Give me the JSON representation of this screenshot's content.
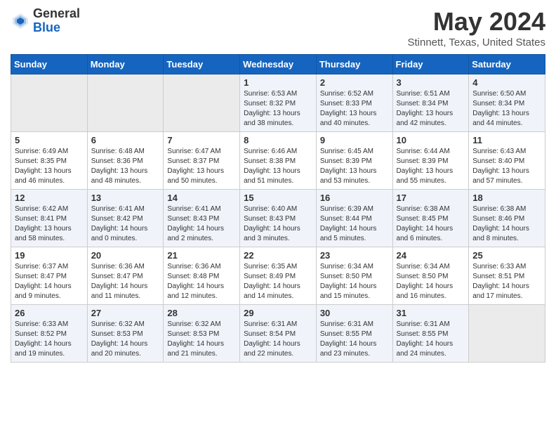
{
  "header": {
    "logo_general": "General",
    "logo_blue": "Blue",
    "title": "May 2024",
    "location": "Stinnett, Texas, United States"
  },
  "days_of_week": [
    "Sunday",
    "Monday",
    "Tuesday",
    "Wednesday",
    "Thursday",
    "Friday",
    "Saturday"
  ],
  "weeks": [
    [
      {
        "day": "",
        "info": ""
      },
      {
        "day": "",
        "info": ""
      },
      {
        "day": "",
        "info": ""
      },
      {
        "day": "1",
        "info": "Sunrise: 6:53 AM\nSunset: 8:32 PM\nDaylight: 13 hours\nand 38 minutes."
      },
      {
        "day": "2",
        "info": "Sunrise: 6:52 AM\nSunset: 8:33 PM\nDaylight: 13 hours\nand 40 minutes."
      },
      {
        "day": "3",
        "info": "Sunrise: 6:51 AM\nSunset: 8:34 PM\nDaylight: 13 hours\nand 42 minutes."
      },
      {
        "day": "4",
        "info": "Sunrise: 6:50 AM\nSunset: 8:34 PM\nDaylight: 13 hours\nand 44 minutes."
      }
    ],
    [
      {
        "day": "5",
        "info": "Sunrise: 6:49 AM\nSunset: 8:35 PM\nDaylight: 13 hours\nand 46 minutes."
      },
      {
        "day": "6",
        "info": "Sunrise: 6:48 AM\nSunset: 8:36 PM\nDaylight: 13 hours\nand 48 minutes."
      },
      {
        "day": "7",
        "info": "Sunrise: 6:47 AM\nSunset: 8:37 PM\nDaylight: 13 hours\nand 50 minutes."
      },
      {
        "day": "8",
        "info": "Sunrise: 6:46 AM\nSunset: 8:38 PM\nDaylight: 13 hours\nand 51 minutes."
      },
      {
        "day": "9",
        "info": "Sunrise: 6:45 AM\nSunset: 8:39 PM\nDaylight: 13 hours\nand 53 minutes."
      },
      {
        "day": "10",
        "info": "Sunrise: 6:44 AM\nSunset: 8:39 PM\nDaylight: 13 hours\nand 55 minutes."
      },
      {
        "day": "11",
        "info": "Sunrise: 6:43 AM\nSunset: 8:40 PM\nDaylight: 13 hours\nand 57 minutes."
      }
    ],
    [
      {
        "day": "12",
        "info": "Sunrise: 6:42 AM\nSunset: 8:41 PM\nDaylight: 13 hours\nand 58 minutes."
      },
      {
        "day": "13",
        "info": "Sunrise: 6:41 AM\nSunset: 8:42 PM\nDaylight: 14 hours\nand 0 minutes."
      },
      {
        "day": "14",
        "info": "Sunrise: 6:41 AM\nSunset: 8:43 PM\nDaylight: 14 hours\nand 2 minutes."
      },
      {
        "day": "15",
        "info": "Sunrise: 6:40 AM\nSunset: 8:43 PM\nDaylight: 14 hours\nand 3 minutes."
      },
      {
        "day": "16",
        "info": "Sunrise: 6:39 AM\nSunset: 8:44 PM\nDaylight: 14 hours\nand 5 minutes."
      },
      {
        "day": "17",
        "info": "Sunrise: 6:38 AM\nSunset: 8:45 PM\nDaylight: 14 hours\nand 6 minutes."
      },
      {
        "day": "18",
        "info": "Sunrise: 6:38 AM\nSunset: 8:46 PM\nDaylight: 14 hours\nand 8 minutes."
      }
    ],
    [
      {
        "day": "19",
        "info": "Sunrise: 6:37 AM\nSunset: 8:47 PM\nDaylight: 14 hours\nand 9 minutes."
      },
      {
        "day": "20",
        "info": "Sunrise: 6:36 AM\nSunset: 8:47 PM\nDaylight: 14 hours\nand 11 minutes."
      },
      {
        "day": "21",
        "info": "Sunrise: 6:36 AM\nSunset: 8:48 PM\nDaylight: 14 hours\nand 12 minutes."
      },
      {
        "day": "22",
        "info": "Sunrise: 6:35 AM\nSunset: 8:49 PM\nDaylight: 14 hours\nand 14 minutes."
      },
      {
        "day": "23",
        "info": "Sunrise: 6:34 AM\nSunset: 8:50 PM\nDaylight: 14 hours\nand 15 minutes."
      },
      {
        "day": "24",
        "info": "Sunrise: 6:34 AM\nSunset: 8:50 PM\nDaylight: 14 hours\nand 16 minutes."
      },
      {
        "day": "25",
        "info": "Sunrise: 6:33 AM\nSunset: 8:51 PM\nDaylight: 14 hours\nand 17 minutes."
      }
    ],
    [
      {
        "day": "26",
        "info": "Sunrise: 6:33 AM\nSunset: 8:52 PM\nDaylight: 14 hours\nand 19 minutes."
      },
      {
        "day": "27",
        "info": "Sunrise: 6:32 AM\nSunset: 8:53 PM\nDaylight: 14 hours\nand 20 minutes."
      },
      {
        "day": "28",
        "info": "Sunrise: 6:32 AM\nSunset: 8:53 PM\nDaylight: 14 hours\nand 21 minutes."
      },
      {
        "day": "29",
        "info": "Sunrise: 6:31 AM\nSunset: 8:54 PM\nDaylight: 14 hours\nand 22 minutes."
      },
      {
        "day": "30",
        "info": "Sunrise: 6:31 AM\nSunset: 8:55 PM\nDaylight: 14 hours\nand 23 minutes."
      },
      {
        "day": "31",
        "info": "Sunrise: 6:31 AM\nSunset: 8:55 PM\nDaylight: 14 hours\nand 24 minutes."
      },
      {
        "day": "",
        "info": ""
      }
    ]
  ]
}
